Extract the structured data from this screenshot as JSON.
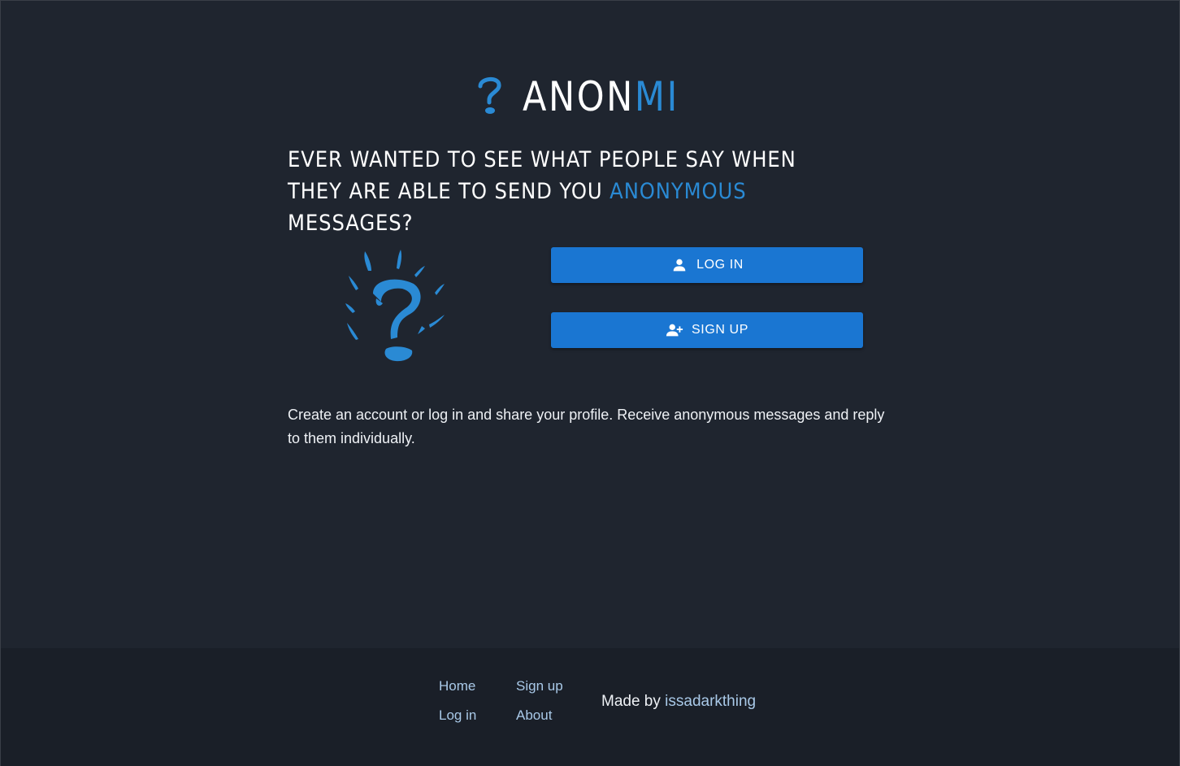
{
  "brand": {
    "name_main": "ANON",
    "name_accent": "MI",
    "accent_color": "#2a8ad4"
  },
  "headline": {
    "part1": "Ever wanted to see what people say when they are able to send you ",
    "accent": "anonymous",
    "part2": " messages?"
  },
  "buttons": {
    "login_label": "LOG IN",
    "login_icon": "person-icon",
    "signup_label": "SIGN UP",
    "signup_icon": "person-add-icon",
    "color": "#1a76d2"
  },
  "description": "Create an account or log in and share your profile. Receive anonymous messages and reply to them individually.",
  "footer": {
    "links": {
      "home": "Home",
      "login": "Log in",
      "signup": "Sign up",
      "about": "About"
    },
    "made_by_prefix": "Made by ",
    "made_by_author": "issadarkthing"
  },
  "colors": {
    "background": "#1f252f",
    "footer_background": "#1a1f28",
    "link": "#a9c9e8"
  }
}
